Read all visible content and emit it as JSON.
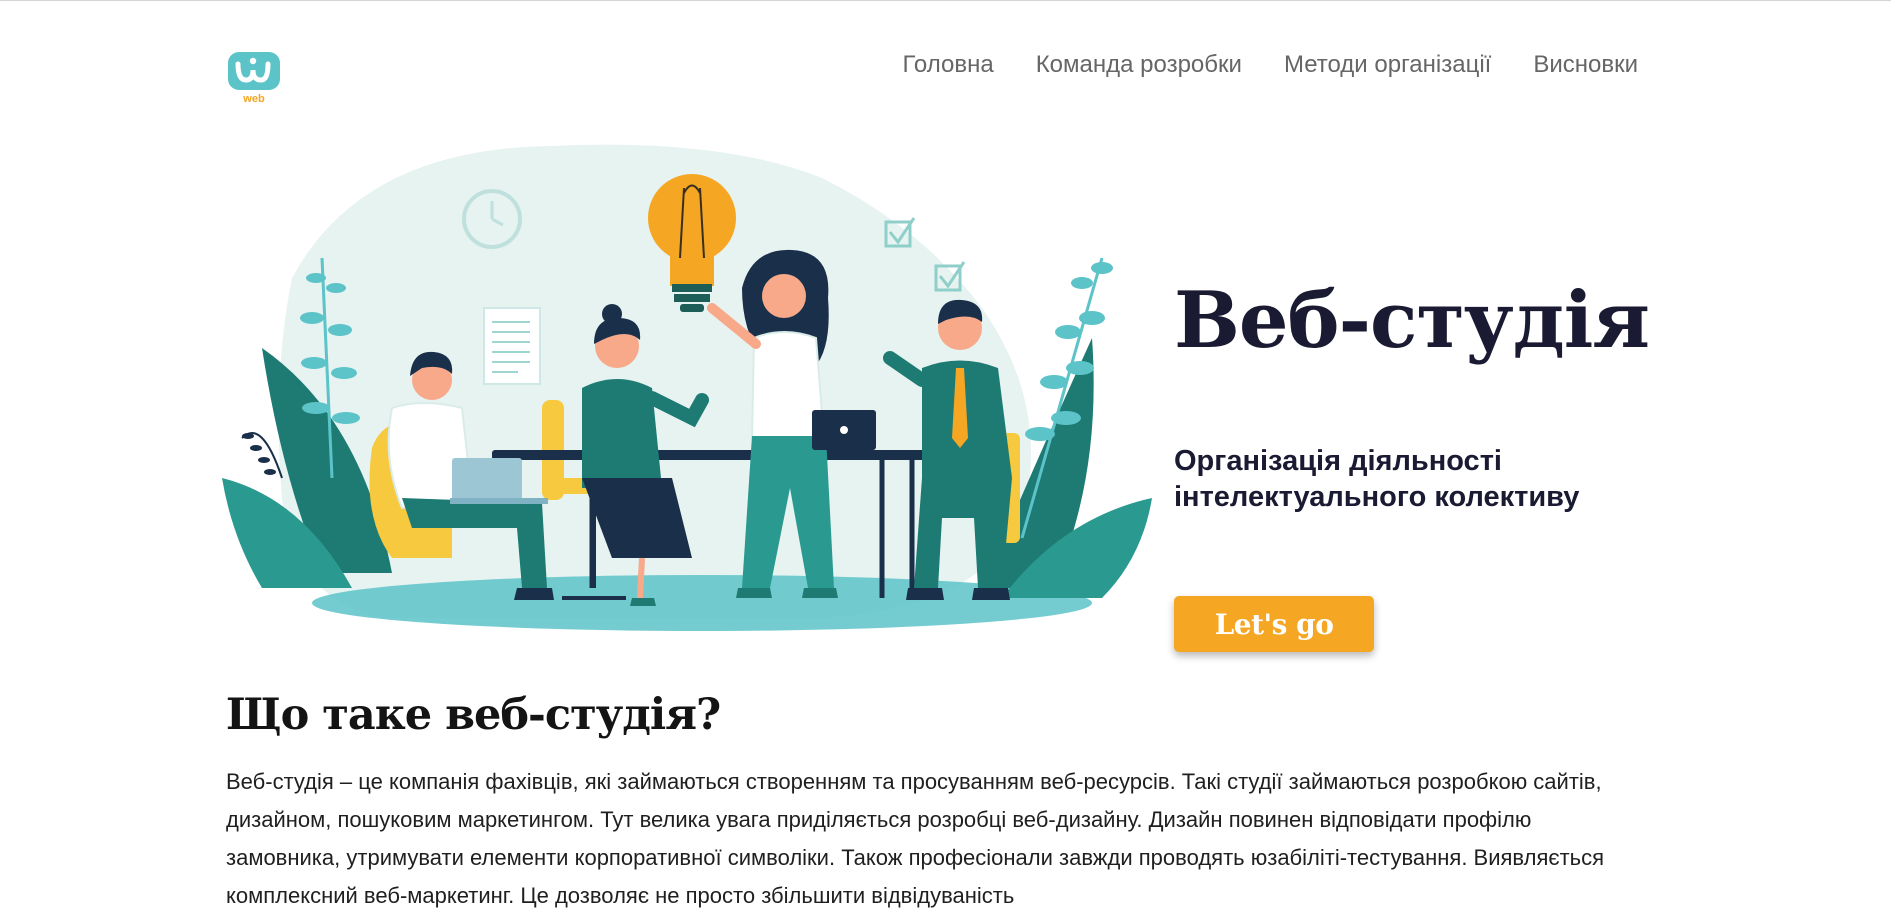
{
  "logo": {
    "text": "web",
    "color": "#5cc3c8",
    "accent": "#f5a623"
  },
  "nav": {
    "items": [
      {
        "label": "Головна"
      },
      {
        "label": "Команда розробки"
      },
      {
        "label": "Методи організації"
      },
      {
        "label": "Висновки"
      }
    ]
  },
  "hero": {
    "title": "Веб-студія",
    "subtitle": "Організація діяльності інтелектуального колективу",
    "cta_label": "Let's go",
    "cta_color": "#f5a623"
  },
  "section": {
    "title": "Що таке веб-студія?",
    "text": "Веб-студія – це компанія фахівців, які займаються створенням та просуванням веб-ресурсів. Такі студії займаються розробкою сайтів, дизайном, пошуковим маркетингом. Тут велика увага приділяється розробці веб-дизайну. Дизайн повинен відповідати профілю замовника, утримувати елементи корпоративної символіки. Також професіонали завжди проводять юзабіліті-тестування. Виявляється комплексний веб-маркетинг. Це дозволяє не просто збільшити відвідуваність"
  },
  "colors": {
    "teal": "#1e7b74",
    "teal_light": "#5cc3c8",
    "blob": "#e6f3f1",
    "yellow": "#f7c93f",
    "dark": "#1a1a33"
  }
}
